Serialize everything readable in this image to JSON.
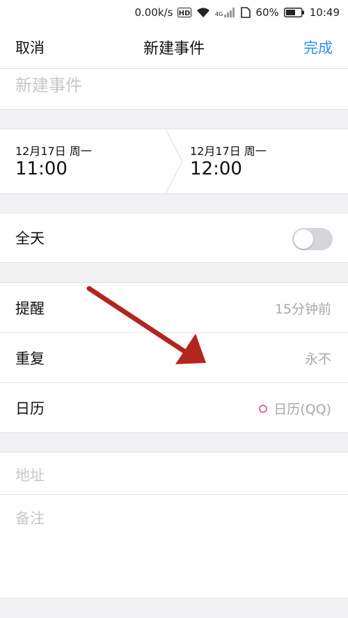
{
  "status_bar": {
    "speed": "0.00k/s",
    "battery": "60%",
    "time": "10:49"
  },
  "nav": {
    "cancel": "取消",
    "title": "新建事件",
    "done": "完成"
  },
  "title_field": {
    "placeholder": "新建事件"
  },
  "time": {
    "start": {
      "date": "12月17日 周一",
      "clock": "11:00"
    },
    "end": {
      "date": "12月17日 周一",
      "clock": "12:00"
    }
  },
  "all_day": {
    "label": "全天",
    "on": false
  },
  "reminder": {
    "label": "提醒",
    "value": "15分钟前"
  },
  "repeat": {
    "label": "重复",
    "value": "永不"
  },
  "calendar": {
    "label": "日历",
    "value": "日历(QQ)",
    "color": "#d86a9a"
  },
  "address": {
    "placeholder": "地址"
  },
  "notes": {
    "placeholder": "备注"
  },
  "colors": {
    "accent": "#2f8ef0",
    "annotation_arrow": "#b3261e"
  }
}
